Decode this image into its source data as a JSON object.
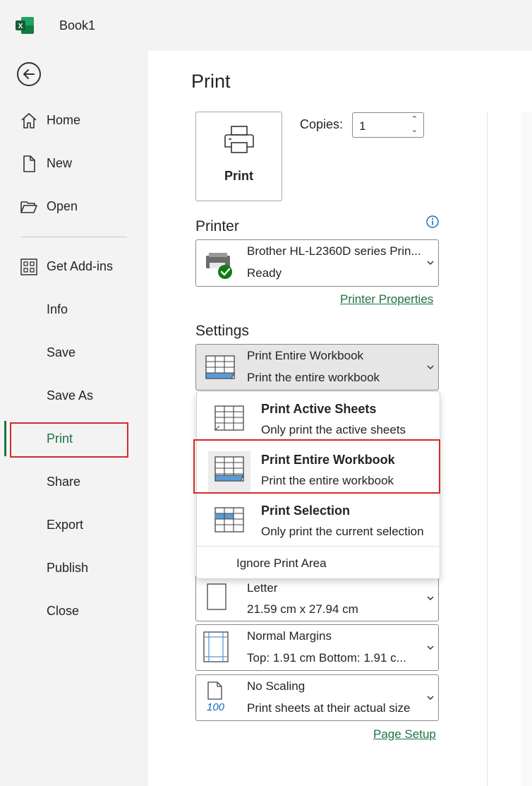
{
  "app": {
    "title": "Book1"
  },
  "nav": {
    "back_icon": "back-arrow-icon",
    "items": [
      {
        "label": "Home",
        "icon": "home-icon"
      },
      {
        "label": "New",
        "icon": "new-document-icon"
      },
      {
        "label": "Open",
        "icon": "open-folder-icon"
      },
      {
        "label": "Get Add-ins",
        "icon": "add-ins-grid-icon"
      },
      {
        "label": "Info"
      },
      {
        "label": "Save"
      },
      {
        "label": "Save As"
      },
      {
        "label": "Print",
        "active": true
      },
      {
        "label": "Share"
      },
      {
        "label": "Export"
      },
      {
        "label": "Publish"
      },
      {
        "label": "Close"
      }
    ]
  },
  "page": {
    "title": "Print",
    "print_button_label": "Print",
    "copies_label": "Copies:",
    "copies_value": "1"
  },
  "printer": {
    "heading": "Printer",
    "name": "Brother HL-L2360D series Prin...",
    "status": "Ready",
    "properties_link": "Printer Properties"
  },
  "settings": {
    "heading": "Settings",
    "selected": {
      "title": "Print Entire Workbook",
      "subtitle": "Print the entire workbook"
    },
    "menu": [
      {
        "title": "Print Active Sheets",
        "subtitle": "Only print the active sheets"
      },
      {
        "title": "Print Entire Workbook",
        "subtitle": "Print the entire workbook",
        "selected": true
      },
      {
        "title": "Print Selection",
        "subtitle": "Only print the current selection"
      }
    ],
    "ignore_print_area": "Ignore Print Area",
    "paper": {
      "title": "Letter",
      "subtitle": "21.59 cm x 27.94 cm"
    },
    "margins": {
      "title": "Normal Margins",
      "subtitle": "Top: 1.91 cm Bottom: 1.91 c..."
    },
    "scaling": {
      "title": "No Scaling",
      "subtitle": "Print sheets at their actual size",
      "icon_text": "100"
    },
    "page_setup_link": "Page Setup"
  },
  "colors": {
    "accent": "#1e7145",
    "highlight_box": "#d62a2a",
    "icon_blue": "#5b9bd5"
  }
}
